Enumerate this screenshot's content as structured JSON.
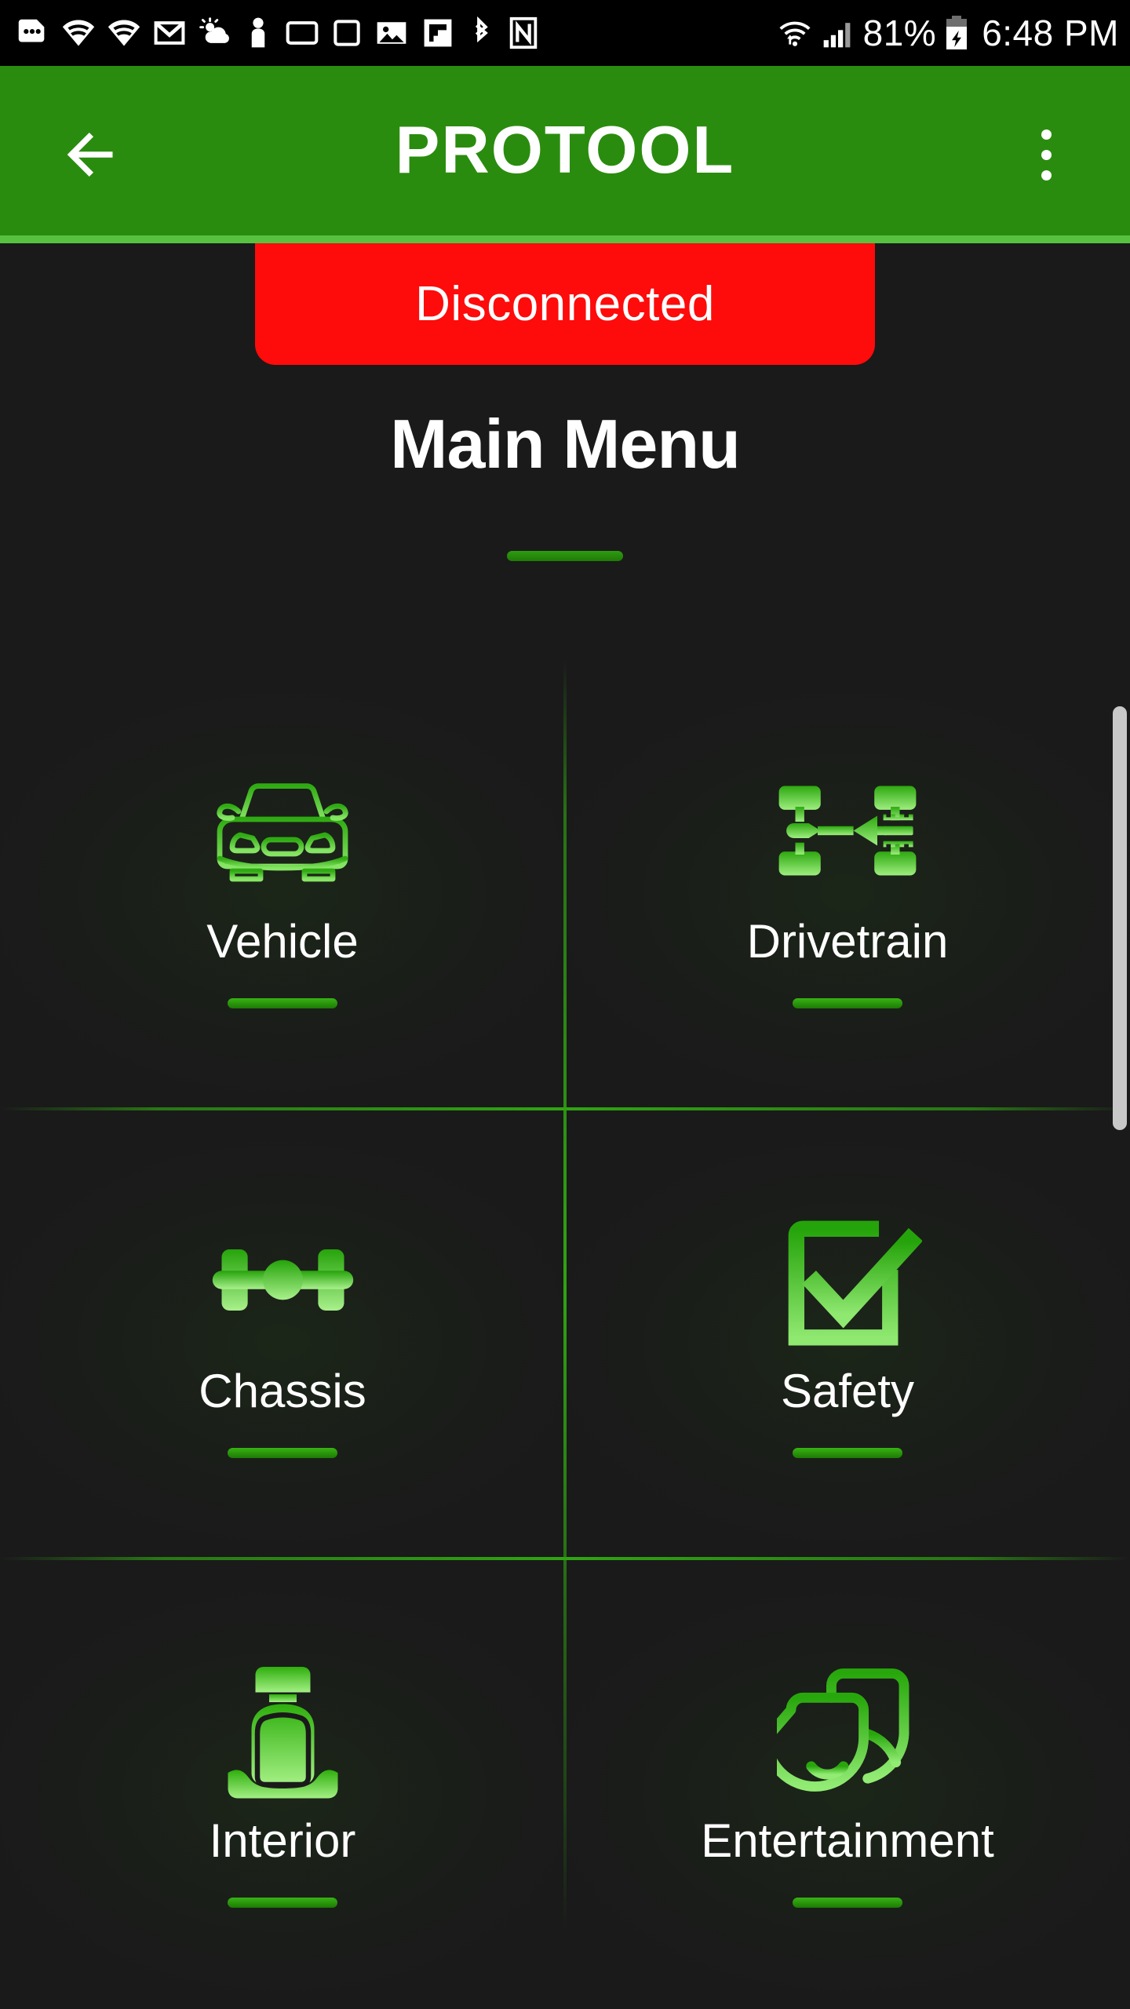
{
  "status_bar": {
    "icons_left": [
      "messages-icon",
      "wifi-icon",
      "wifi-icon-2",
      "gmail-icon",
      "weather-icon",
      "person-icon",
      "monitor-icon",
      "monitor-icon-2",
      "photo-icon",
      "flipboard-icon",
      "bluetooth-icon",
      "nfc-icon"
    ],
    "wifi_label": "wifi-icon",
    "signal_label": "cell-signal-icon",
    "battery_percent": "81%",
    "battery_label": "battery-charging-icon",
    "clock": "6:48 PM"
  },
  "app_bar": {
    "back_label": "back-arrow-icon",
    "title": "PROTOOL",
    "overflow_label": "overflow-menu-icon",
    "background_color": "#2a8c0e"
  },
  "connection": {
    "status": "Disconnected",
    "color": "#fe0b0b"
  },
  "page": {
    "title": "Main Menu",
    "accent_color": "#2fa512"
  },
  "menu": {
    "items": [
      {
        "label": "Vehicle",
        "icon": "car-front-icon"
      },
      {
        "label": "Drivetrain",
        "icon": "drivetrain-icon"
      },
      {
        "label": "Chassis",
        "icon": "chassis-axle-icon"
      },
      {
        "label": "Safety",
        "icon": "checkbox-check-icon"
      },
      {
        "label": "Interior",
        "icon": "car-seat-icon"
      },
      {
        "label": "Entertainment",
        "icon": "screens-icon"
      }
    ]
  },
  "scrollbar": {
    "label": "vertical-scrollbar"
  }
}
